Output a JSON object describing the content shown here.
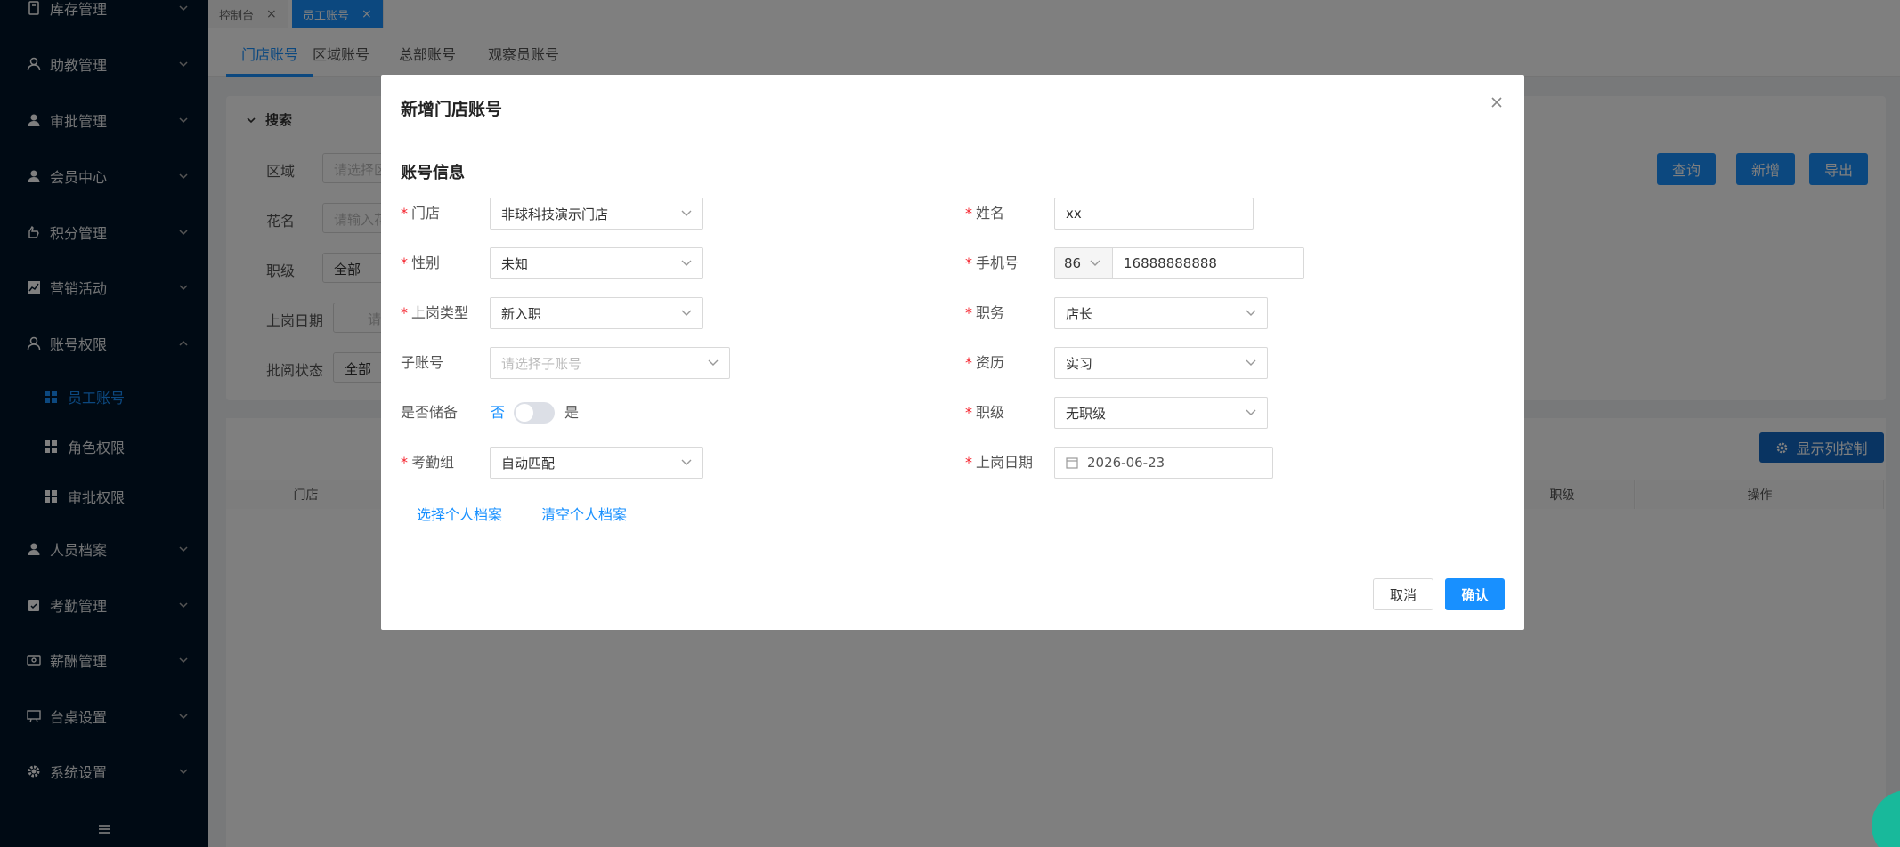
{
  "sidebar": {
    "items": [
      {
        "label": "库存管理",
        "icon": "box-icon"
      },
      {
        "label": "助教管理",
        "icon": "user-icon"
      },
      {
        "label": "审批管理",
        "icon": "person-icon"
      },
      {
        "label": "会员中心",
        "icon": "person-icon"
      },
      {
        "label": "积分管理",
        "icon": "hand-icon"
      },
      {
        "label": "营销活动",
        "icon": "chart-icon"
      },
      {
        "label": "账号权限",
        "icon": "user-icon"
      },
      {
        "label": "人员档案",
        "icon": "person-icon"
      },
      {
        "label": "考勤管理",
        "icon": "clipboard-icon"
      },
      {
        "label": "薪酬管理",
        "icon": "money-icon"
      },
      {
        "label": "台桌设置",
        "icon": "table-icon"
      },
      {
        "label": "系统设置",
        "icon": "gear-icon"
      }
    ],
    "subitems": [
      {
        "label": "员工账号",
        "active": true
      },
      {
        "label": "角色权限",
        "active": false
      },
      {
        "label": "审批权限",
        "active": false
      }
    ]
  },
  "page_tabs": [
    {
      "label": "控制台",
      "active": false
    },
    {
      "label": "员工账号",
      "active": true
    }
  ],
  "sub_tabs": [
    "门店账号",
    "区域账号",
    "总部账号",
    "观察员账号"
  ],
  "search": {
    "title": "搜索",
    "region_label": "区域",
    "region_placeholder": "请选择区域",
    "flower_label": "花名",
    "flower_placeholder": "请输入花名",
    "rank_label": "职级",
    "rank_value": "全部",
    "onboard_label": "上岗日期",
    "onboard_placeholder": "请",
    "review_label": "批阅状态",
    "review_value": "全部",
    "query_btn": "查询",
    "add_btn": "新增",
    "export_btn": "导出"
  },
  "table": {
    "column_control_btn": "显示列控制",
    "headers": [
      "门店",
      "职级",
      "操作"
    ]
  },
  "modal": {
    "title": "新增门店账号",
    "section": "账号信息",
    "store_label": "门店",
    "store_value": "非球科技演示门店",
    "gender_label": "性别",
    "gender_value": "未知",
    "onboard_type_label": "上岗类型",
    "onboard_type_value": "新入职",
    "sub_account_label": "子账号",
    "sub_account_placeholder": "请选择子账号",
    "reserve_label": "是否储备",
    "reserve_no": "否",
    "reserve_yes": "是",
    "attendance_label": "考勤组",
    "attendance_value": "自动匹配",
    "name_label": "姓名",
    "name_value": "xx",
    "phone_label": "手机号",
    "phone_code": "86",
    "phone_value": "16888888888",
    "position_label": "职务",
    "position_value": "店长",
    "seniority_label": "资历",
    "seniority_value": "实习",
    "rank_label": "职级",
    "rank_value": "无职级",
    "date_label": "上岗日期",
    "date_value": "2026-06-23",
    "select_profile": "选择个人档案",
    "clear_profile": "清空个人档案",
    "cancel_btn": "取消",
    "confirm_btn": "确认"
  },
  "colors": {
    "primary": "#1890ff",
    "sidebar_bg": "#001529",
    "required": "#f5222d"
  }
}
